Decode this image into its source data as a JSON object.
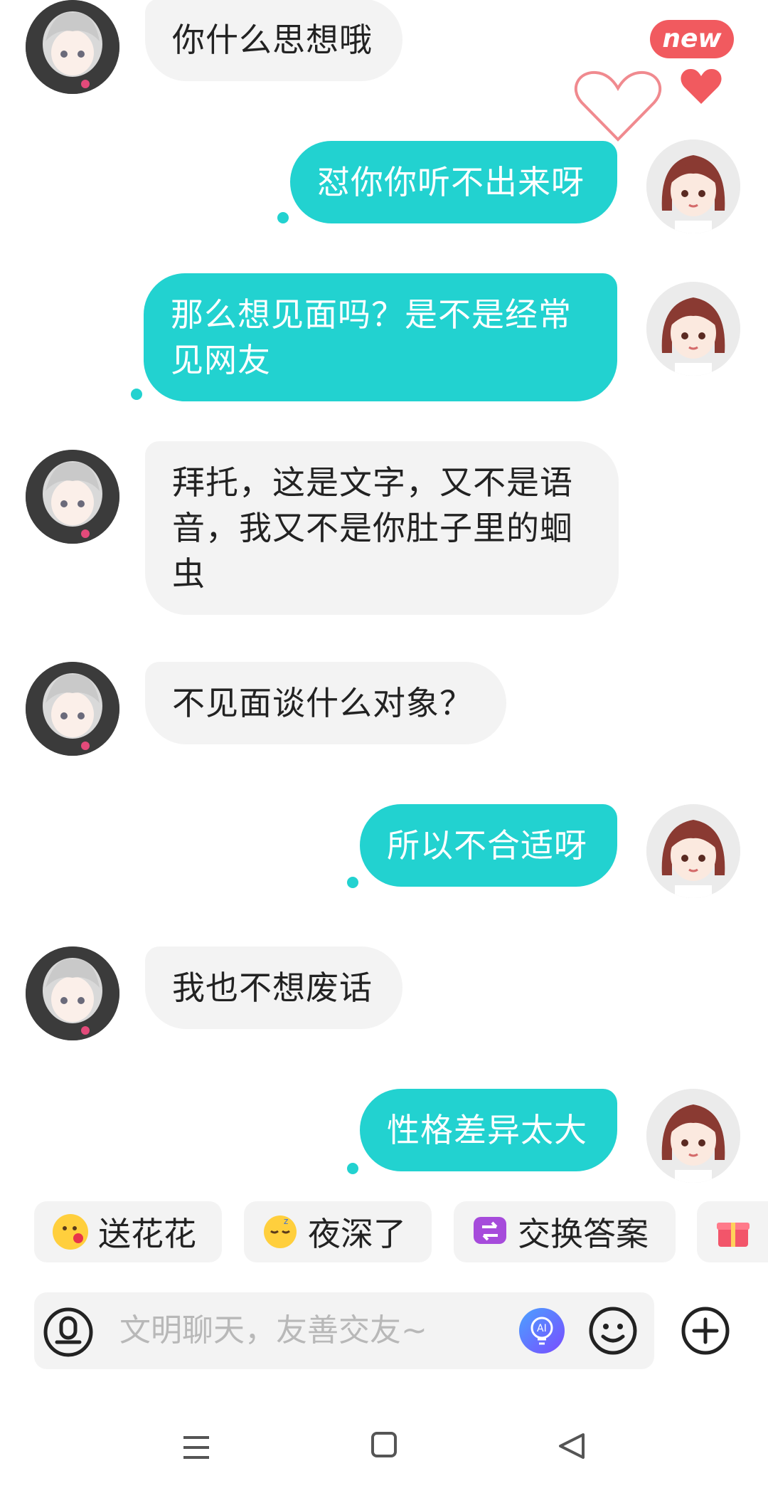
{
  "badge": {
    "new_label": "new"
  },
  "messages": [
    {
      "side": "other",
      "text": "你什么思想哦"
    },
    {
      "side": "self",
      "text": "怼你你听不出来呀"
    },
    {
      "side": "self",
      "text": "那么想见面吗？是不是经常见网友"
    },
    {
      "side": "other",
      "text": "拜托，这是文字，又不是语音，我又不是你肚子里的蛔虫"
    },
    {
      "side": "other",
      "text": "不见面谈什么对象？"
    },
    {
      "side": "self",
      "text": "所以不合适呀"
    },
    {
      "side": "other",
      "text": "我也不想废话"
    },
    {
      "side": "self",
      "text": "性格差异太大"
    }
  ],
  "quick_chips": [
    {
      "label": "送花花",
      "icon": "flower-face-emoji-icon"
    },
    {
      "label": "夜深了",
      "icon": "sleeping-face-emoji-icon"
    },
    {
      "label": "交换答案",
      "icon": "swap-icon"
    },
    {
      "label": "",
      "icon": "gift-icon"
    }
  ],
  "input": {
    "placeholder": "文明聊天，友善交友~"
  },
  "colors": {
    "accent": "#22d2d0",
    "heart": "#f15a5f",
    "bubble_other": "#f3f3f3"
  },
  "icons": {
    "voice": "voice-icon",
    "ai": "ai-bulb-icon",
    "emoji": "smiley-icon",
    "plus": "plus-icon",
    "nav_menu": "menu-icon",
    "nav_home": "home-square-icon",
    "nav_back": "back-triangle-icon",
    "heart": "heart-icon"
  }
}
